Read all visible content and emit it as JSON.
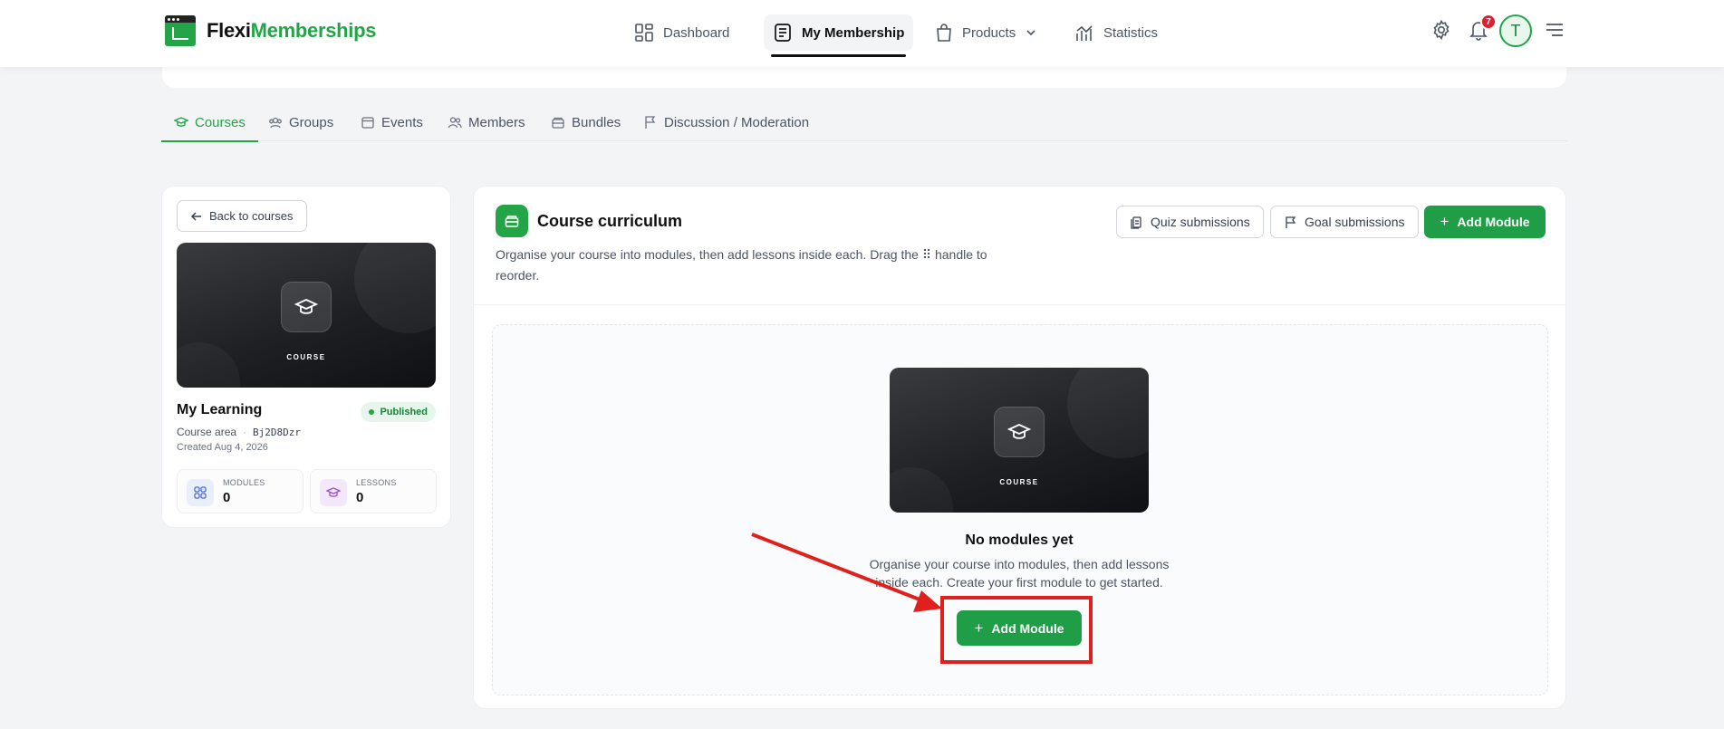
{
  "brand": {
    "name_part1": "Flexi",
    "name_part2": "Memberships"
  },
  "nav": [
    {
      "label": "Dashboard"
    },
    {
      "label": "My Membership"
    },
    {
      "label": "Products"
    },
    {
      "label": "Statistics"
    }
  ],
  "header": {
    "notification_count": "7",
    "avatar_initial": "T"
  },
  "tabs": [
    {
      "label": "Courses"
    },
    {
      "label": "Groups"
    },
    {
      "label": "Events"
    },
    {
      "label": "Members"
    },
    {
      "label": "Bundles"
    },
    {
      "label": "Discussion / Moderation"
    }
  ],
  "course": {
    "back_label": "Back to courses",
    "cover_label": "COURSE",
    "title": "My Learning",
    "status": "Published",
    "area": "Course area",
    "code": "Bj2D8Dzr",
    "created": "Created Aug 4, 2026",
    "stats": [
      {
        "label": "MODULES",
        "value": "0"
      },
      {
        "label": "LESSONS",
        "value": "0"
      }
    ]
  },
  "curriculum": {
    "title": "Course curriculum",
    "description": "Organise your course into modules, then add lessons inside each. Drag the ⠿ handle to reorder.",
    "quiz_label": "Quiz submissions",
    "goal_label": "Goal submissions",
    "add_module_label": "Add Module",
    "empty": {
      "cover_label": "COURSE",
      "title": "No modules yet",
      "description": "Organise your course into modules, then add lessons inside each. Create your first module to get started.",
      "button_label": "Add Module"
    }
  },
  "colors": {
    "accent": "#22a447",
    "highlight": "#e0201c"
  }
}
